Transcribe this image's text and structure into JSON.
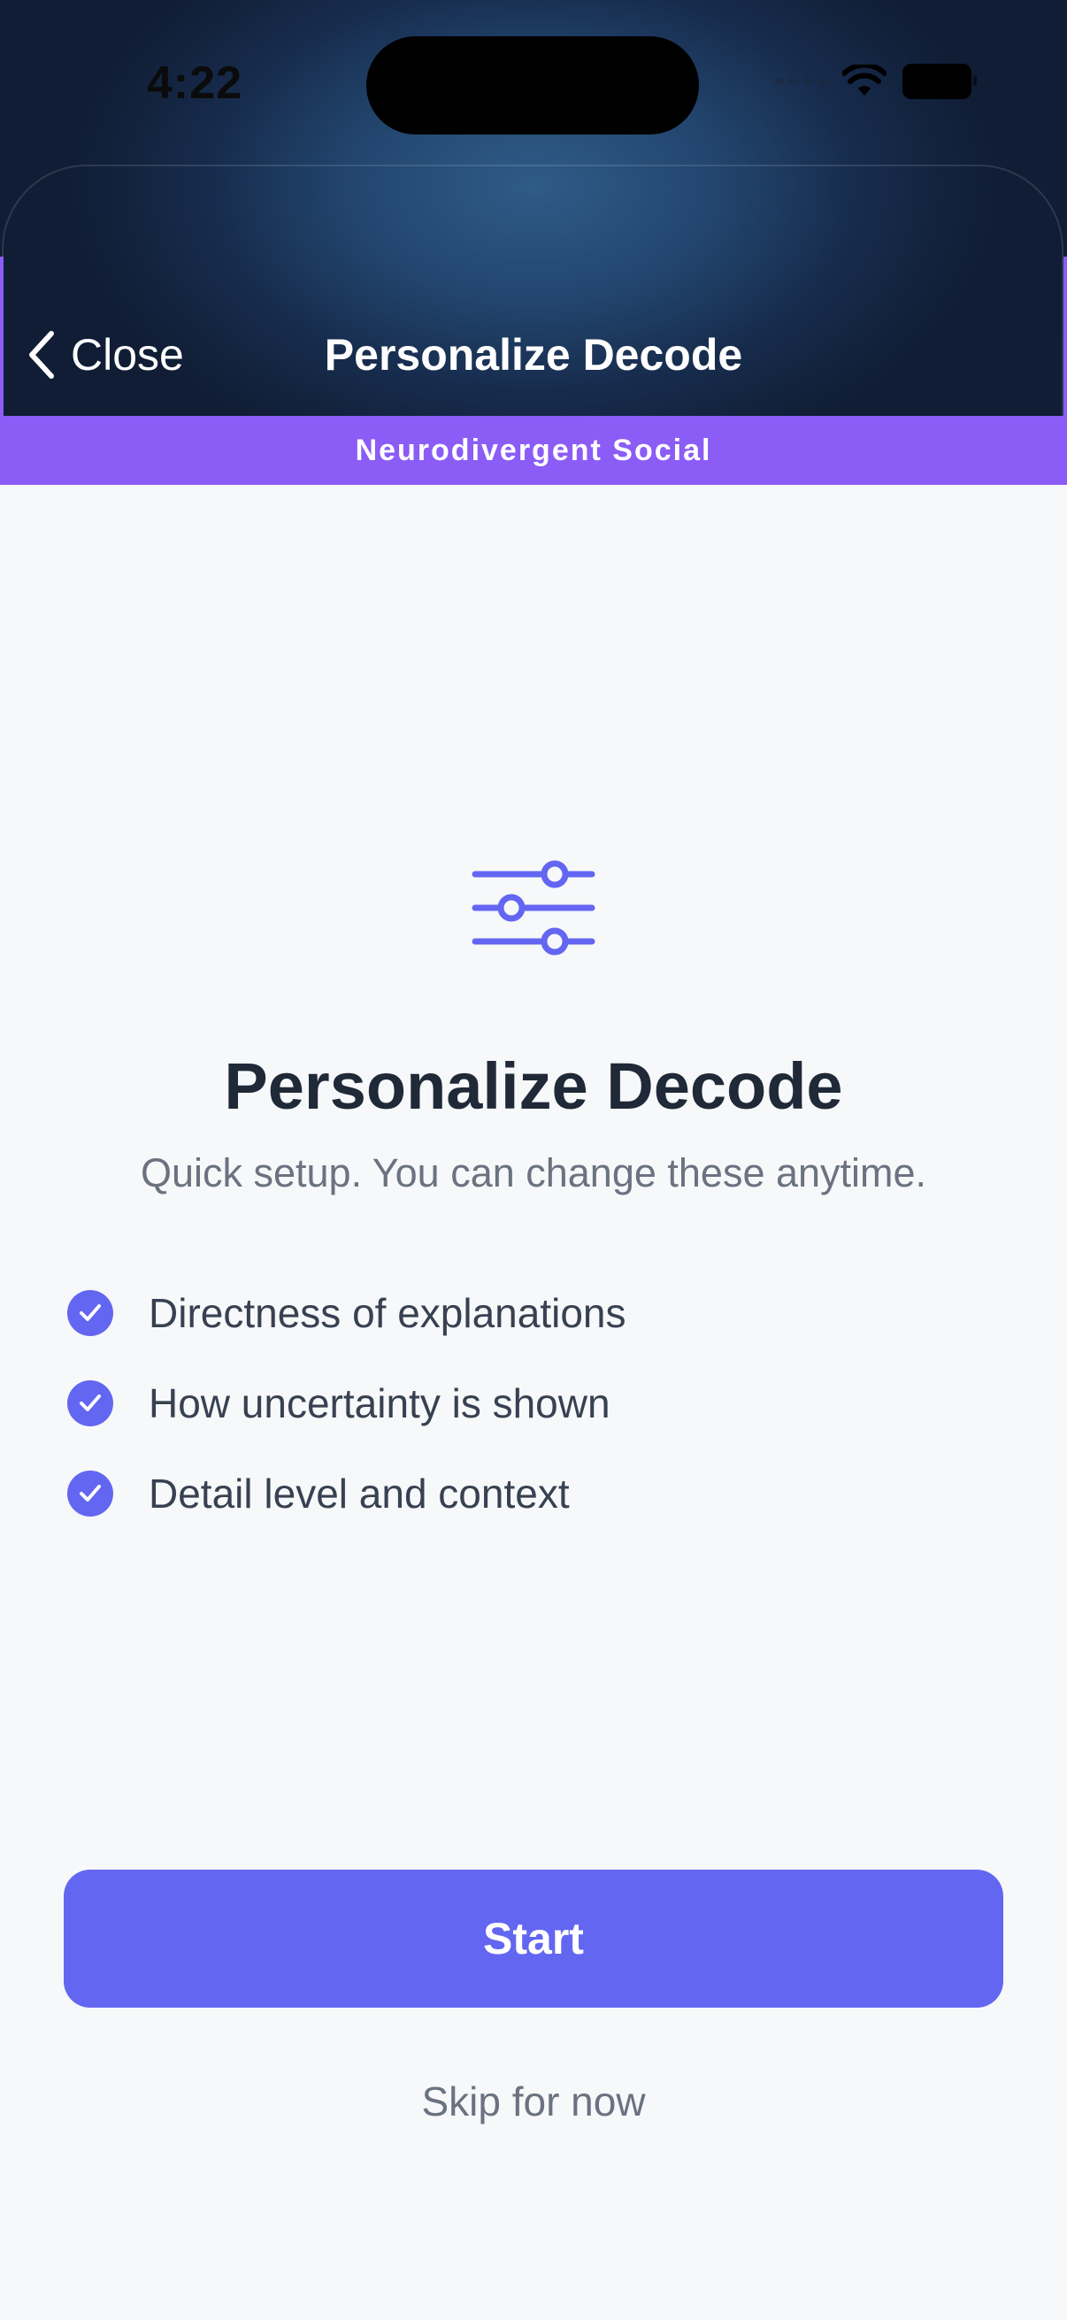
{
  "status_bar": {
    "time": "4:22",
    "icons": [
      "cellular-signal-icon",
      "wifi-icon",
      "battery-icon"
    ]
  },
  "nav": {
    "back_label": "Close",
    "back_icon": "chevron-left-icon",
    "title": "Personalize Decode"
  },
  "banner": {
    "label": "Neurodivergent Social"
  },
  "hero": {
    "icon": "sliders-icon",
    "title": "Personalize Decode",
    "subtitle": "Quick setup. You can change these anytime."
  },
  "features": [
    {
      "label": "Directness of explanations",
      "icon": "check-circle-icon"
    },
    {
      "label": "How uncertainty is shown",
      "icon": "check-circle-icon"
    },
    {
      "label": "Detail level and context",
      "icon": "check-circle-icon"
    }
  ],
  "actions": {
    "start_label": "Start",
    "skip_label": "Skip for now"
  },
  "colors": {
    "accent": "#6366f1",
    "banner": "#8b5cf6",
    "header_bg": "#1a3358",
    "page_bg": "#f7f8fa",
    "title_text": "#1f2937",
    "muted_text": "#6b7280"
  }
}
